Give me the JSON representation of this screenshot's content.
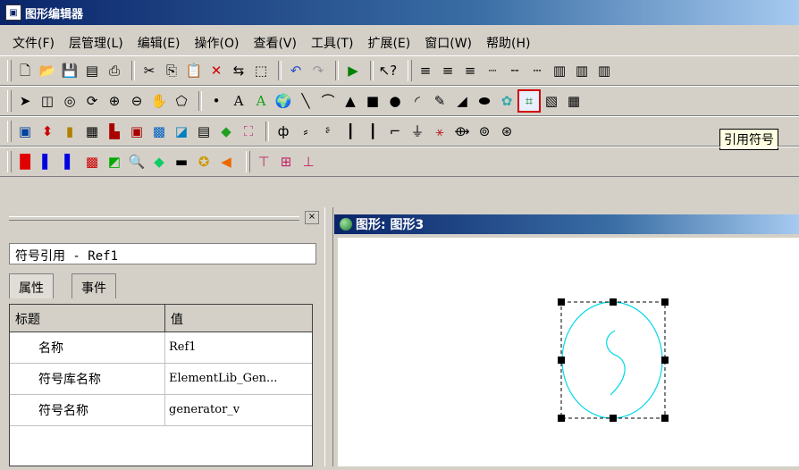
{
  "titlebar": {
    "title": "图形编辑器",
    "icon": "app-icon"
  },
  "menu": [
    "文件(F)",
    "层管理(L)",
    "编辑(E)",
    "操作(O)",
    "查看(V)",
    "工具(T)",
    "扩展(E)",
    "窗口(W)",
    "帮助(H)"
  ],
  "toolbar": {
    "tooltip": "引用符号"
  },
  "panel": {
    "object_name": "符号引用 - Ref1",
    "tabs": [
      "属性",
      "事件"
    ],
    "close_label": "×",
    "grid": {
      "headers": [
        "标题",
        "值"
      ],
      "rows": [
        {
          "name": "名称",
          "value": "Ref1"
        },
        {
          "name": "符号库名称",
          "value": "ElementLib_Gen..."
        },
        {
          "name": "符号名称",
          "value": "generator_v"
        }
      ]
    }
  },
  "document": {
    "title": "图形: 图形3"
  },
  "colors": {
    "accent": "#0a246a",
    "shape_stroke": "#00d8e8",
    "highlight": "#d00000"
  }
}
